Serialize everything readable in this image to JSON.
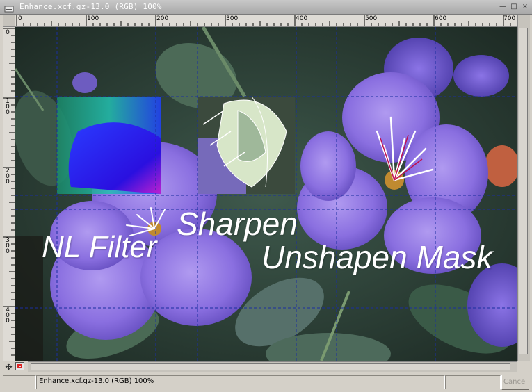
{
  "window": {
    "title": "Enhance.xcf.gz-13.0 (RGB) 100%",
    "controls": {
      "minimize": "—",
      "maximize": "□",
      "close": "×"
    }
  },
  "rulers": {
    "horizontal": [
      "0",
      "100",
      "200",
      "300",
      "400",
      "500",
      "600",
      "700"
    ],
    "vertical": [
      "0",
      "100",
      "200",
      "300",
      "400"
    ]
  },
  "canvas": {
    "overlays": {
      "nl_filter": "NL Filter",
      "sharpen": "Sharpen",
      "unsharp_mask": "Unshapen Mask"
    },
    "guide_color": "#1a2ea0",
    "flower_color": "#8a6fe0"
  },
  "status": {
    "text": "Enhance.xcf.gz-13.0 (RGB) 100%",
    "cancel_label": "Cancel"
  },
  "icons": {
    "menu": "window-menu-icon",
    "navigate": "navigate-icon",
    "quickmask": "quick-mask-icon"
  }
}
